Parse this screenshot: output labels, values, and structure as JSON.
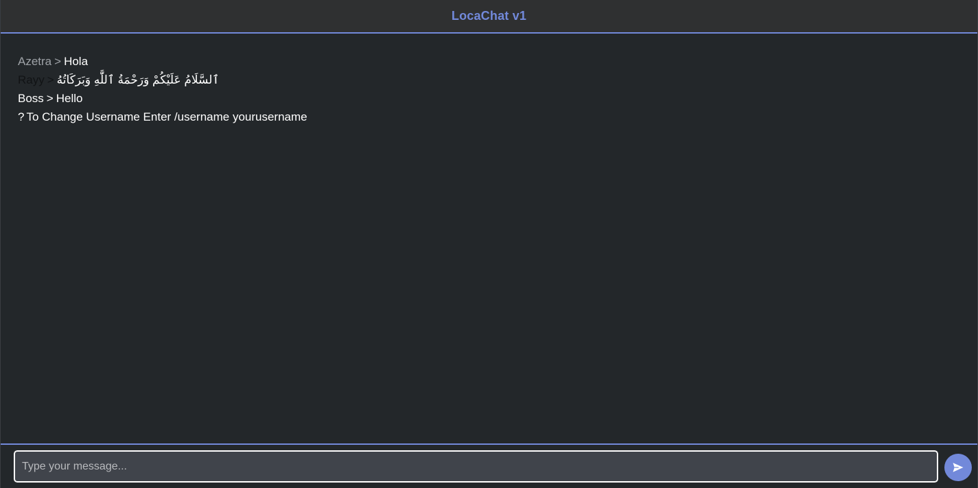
{
  "app": {
    "title": "LocaChat v1"
  },
  "messages": [
    {
      "user": "Azetra",
      "separator": ">",
      "text": "Hola",
      "user_color": "#9ea2a7",
      "text_color": "#ffffff"
    },
    {
      "user": "Rayy",
      "separator": ">",
      "text": "ٱلسَّلَامُ عَلَيْكُمْ وَرَحْمَةُ ٱللَّٰهِ وَبَرَكَاتُهُ",
      "user_color": "#111315",
      "text_color": "#ffffff"
    },
    {
      "user": "Boss",
      "separator": ">",
      "text": "Hello",
      "user_color": "#ffffff",
      "text_color": "#ffffff"
    },
    {
      "user": "?",
      "separator": "",
      "text": "To Change Username Enter /username yourusername",
      "user_color": "#ffffff",
      "text_color": "#ffffff"
    }
  ],
  "composer": {
    "placeholder": "Type your message...",
    "value": "",
    "send_icon": "send-icon"
  },
  "colors": {
    "accent": "#7289da",
    "background": "#23272a",
    "header_background": "#2f3031",
    "input_background": "#40444b"
  }
}
